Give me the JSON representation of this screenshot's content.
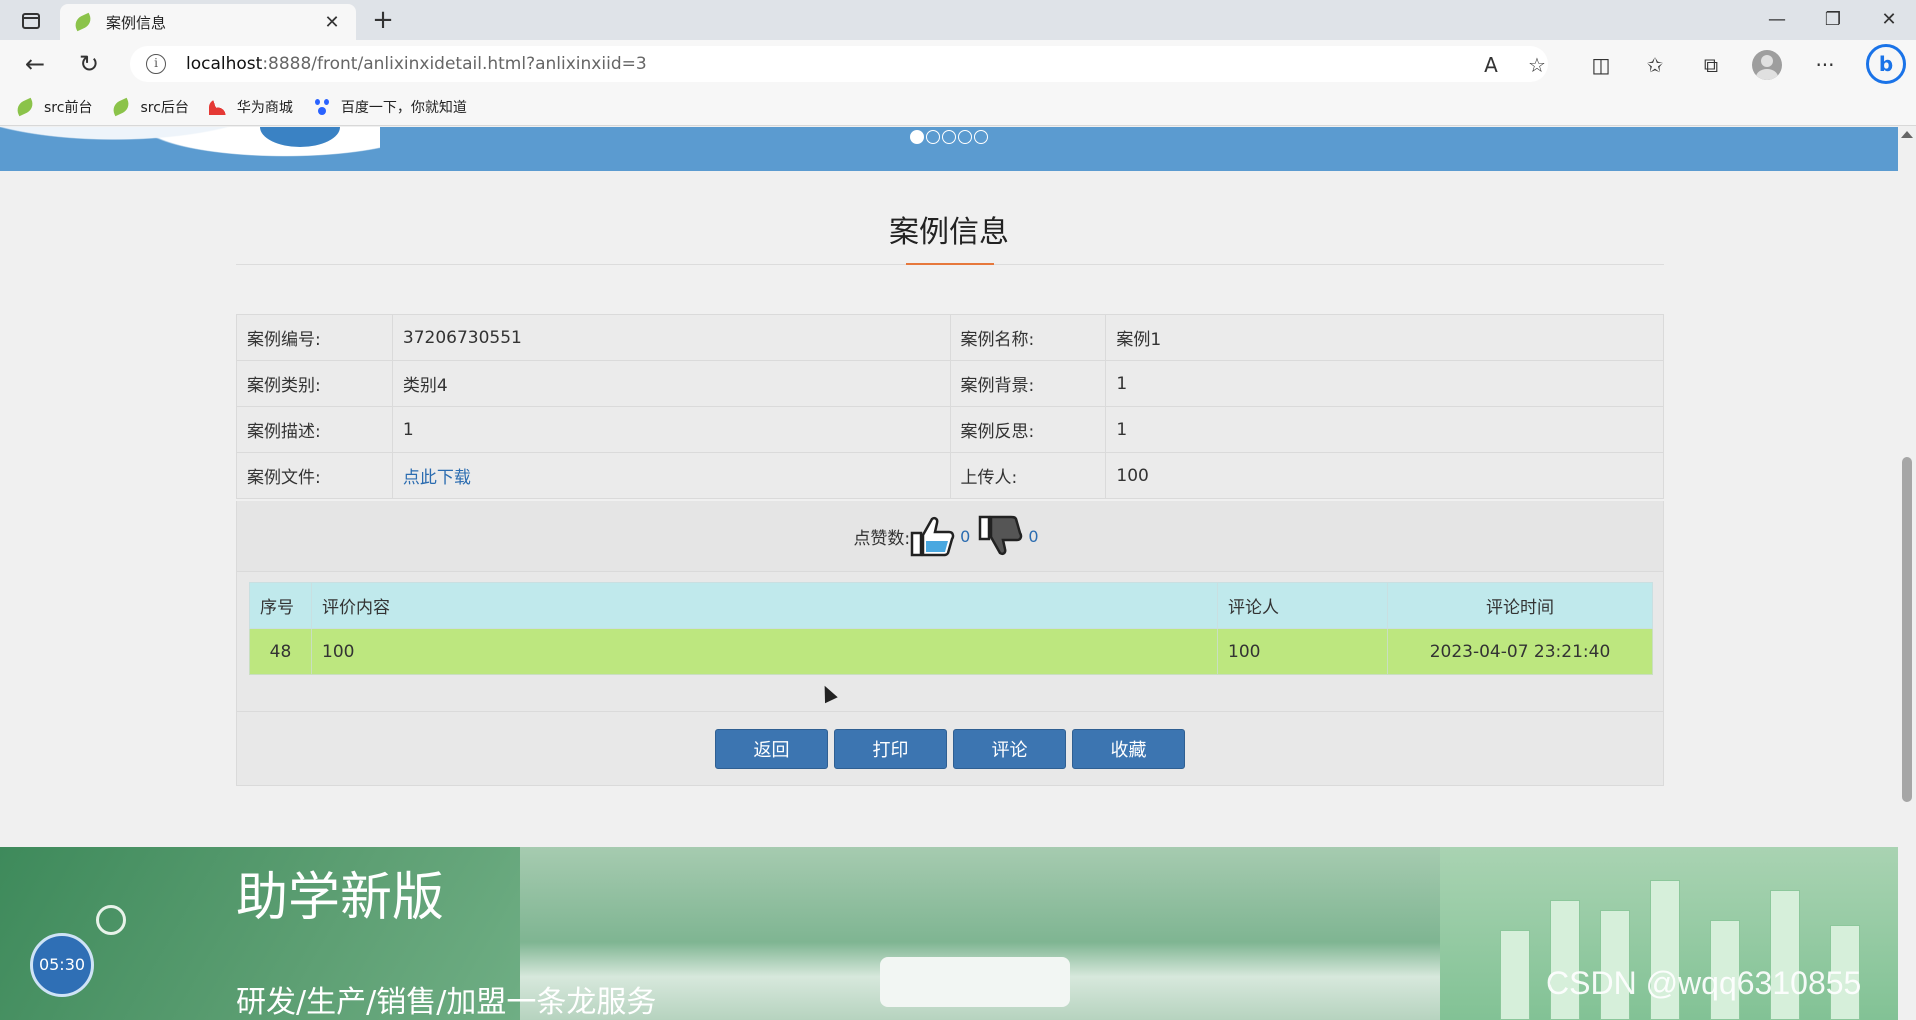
{
  "browser": {
    "tab_title": "案例信息",
    "url_host": "localhost",
    "url_rest": ":8888/front/anlixinxidetail.html?anlixinxiid=3",
    "bookmarks": [
      {
        "label": "src前台",
        "icon": "leaf-icon"
      },
      {
        "label": "src后台",
        "icon": "leaf-icon"
      },
      {
        "label": "华为商城",
        "icon": "huawei-icon"
      },
      {
        "label": "百度一下，你就知道",
        "icon": "baidu-paw-icon"
      }
    ]
  },
  "page": {
    "title": "案例信息",
    "details": [
      {
        "label": "案例编号:",
        "value": "37206730551",
        "label2": "案例名称:",
        "value2": "案例1"
      },
      {
        "label": "案例类别:",
        "value": "类别4",
        "label2": "案例背景:",
        "value2": "1"
      },
      {
        "label": "案例描述:",
        "value": "1",
        "label2": "案例反思:",
        "value2": "1"
      },
      {
        "label": "案例文件:",
        "value": "点此下载",
        "label2": "上传人:",
        "value2": "100"
      }
    ],
    "likes": {
      "label": "点赞数:",
      "up_count": "0",
      "down_count": "0"
    },
    "comments": {
      "headers": [
        "序号",
        "评价内容",
        "评论人",
        "评论时间"
      ],
      "rows": [
        {
          "index": "48",
          "content": "100",
          "author": "100",
          "time": "2023-04-07 23:21:40"
        }
      ]
    },
    "buttons": {
      "back": "返回",
      "print": "打印",
      "comment": "评论",
      "favorite": "收藏"
    },
    "footer": {
      "headline": "助学新版",
      "subline": "研发/生产/销售/加盟一条龙服务",
      "timer": "05:30",
      "watermark": "CSDN @wqq6310855"
    }
  },
  "colors": {
    "primary_button": "#3c75b1",
    "title_accent": "#e6783c",
    "comment_header": "#c0e9ec",
    "comment_row": "#bde77f",
    "banner_blue": "#5b9bd0"
  }
}
